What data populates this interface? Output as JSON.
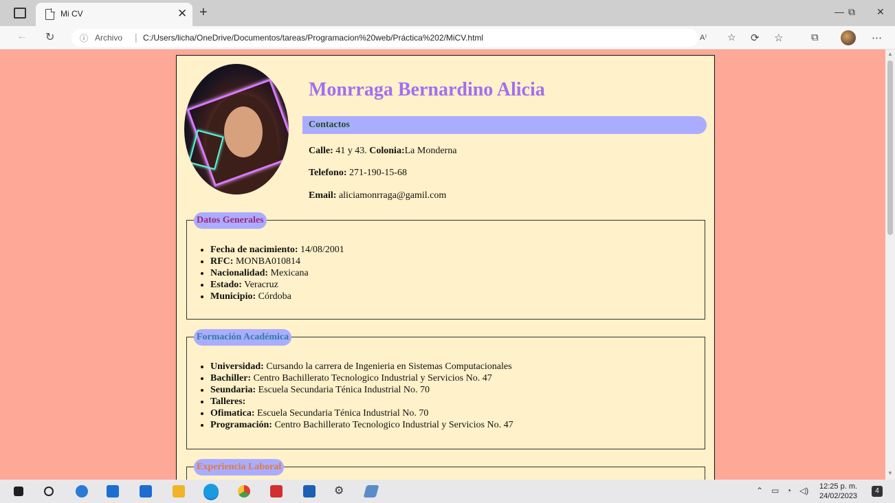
{
  "tab": {
    "title": "Mi CV",
    "close": "✕",
    "new": "+"
  },
  "window": {
    "minimize": "—",
    "restore": "⧉",
    "close": "✕"
  },
  "address": {
    "info": "ⓘ",
    "archivo": "Archivo",
    "sep": "|",
    "url": "C:/Users/licha/OneDrive/Documentos/tareas/Programacion%20web/Práctica%202/MiCV.html",
    "read_aloud": "A⁾"
  },
  "nav": {
    "back": "←",
    "reload": "↻"
  },
  "cv": {
    "name": "Monrraga Bernardino Alicia",
    "contactos_label": "Contactos",
    "calle_label": "Calle:",
    "calle_value": " 41 y 43. ",
    "colonia_label": "Colonia:",
    "colonia_value": "La Monderna",
    "telefono_label": "Telefono:",
    "telefono_value": " 271-190-15-68",
    "email_label": "Email:",
    "email_value": " aliciamonrraga@gamil.com",
    "datos": {
      "title": "Datos Generales",
      "title_color": "#a0247a",
      "items": [
        {
          "label": "Fecha de nacimiento:",
          "value": " 14/08/2001"
        },
        {
          "label": "RFC:",
          "value": " MONBA010814"
        },
        {
          "label": "Nacionalidad:",
          "value": " Mexicana"
        },
        {
          "label": "Estado:",
          "value": " Veracruz"
        },
        {
          "label": "Municipio:",
          "value": " Córdoba"
        }
      ]
    },
    "formacion": {
      "title": "Formación Académica",
      "title_color": "#2e7da3",
      "items": [
        {
          "label": "Universidad:",
          "value": " Cursando la carrera de Ingenieria en Sistemas Computacionales"
        },
        {
          "label": "Bachiller:",
          "value": " Centro Bachillerato Tecnologico Industrial y Servicios No. 47"
        },
        {
          "label": "Seundaria:",
          "value": " Escuela Secundaria Ténica Industrial No. 70"
        },
        {
          "label": "Talleres:",
          "value": ""
        },
        {
          "label": "Ofimatica:",
          "value": " Escuela Secundaria Ténica Industrial No. 70"
        },
        {
          "label": "Programación:",
          "value": " Centro Bachillerato Tecnologico Industrial y Servicios No. 47"
        }
      ]
    },
    "experiencia": {
      "title": "Experiencia Laboral",
      "title_color": "#e07a3f"
    }
  },
  "colors": {
    "page_bg": "#fea898",
    "card_bg": "#fff1c9",
    "accent_bar": "#aaadff",
    "name": "#a36ef0"
  },
  "taskbar": {
    "time": "12:25 p. m.",
    "date": "24/02/2023",
    "notifications": "4"
  }
}
